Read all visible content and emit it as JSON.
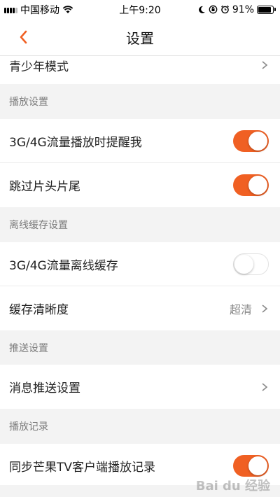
{
  "status_bar": {
    "carrier": "中国移动",
    "time": "上午9:20",
    "battery_percent": "91%",
    "battery_level": 0.91
  },
  "header": {
    "title": "设置"
  },
  "rows": {
    "teen_mode": "青少年模式",
    "playback_section": "播放设置",
    "remind_3g4g": "3G/4G流量播放时提醒我",
    "skip_intro": "跳过片头片尾",
    "offline_section": "离线缓存设置",
    "offline_3g4g": "3G/4G流量离线缓存",
    "cache_quality": "缓存清晰度",
    "cache_quality_value": "超清",
    "push_section": "推送设置",
    "push_settings": "消息推送设置",
    "history_section": "播放记录",
    "sync_history": "同步芒果TV客户端播放记录"
  },
  "toggles": {
    "remind_3g4g": true,
    "skip_intro": true,
    "offline_3g4g": false,
    "sync_history": true
  },
  "colors": {
    "accent": "#f06023",
    "background": "#f3f3f3"
  },
  "watermark": "Baidu经验"
}
